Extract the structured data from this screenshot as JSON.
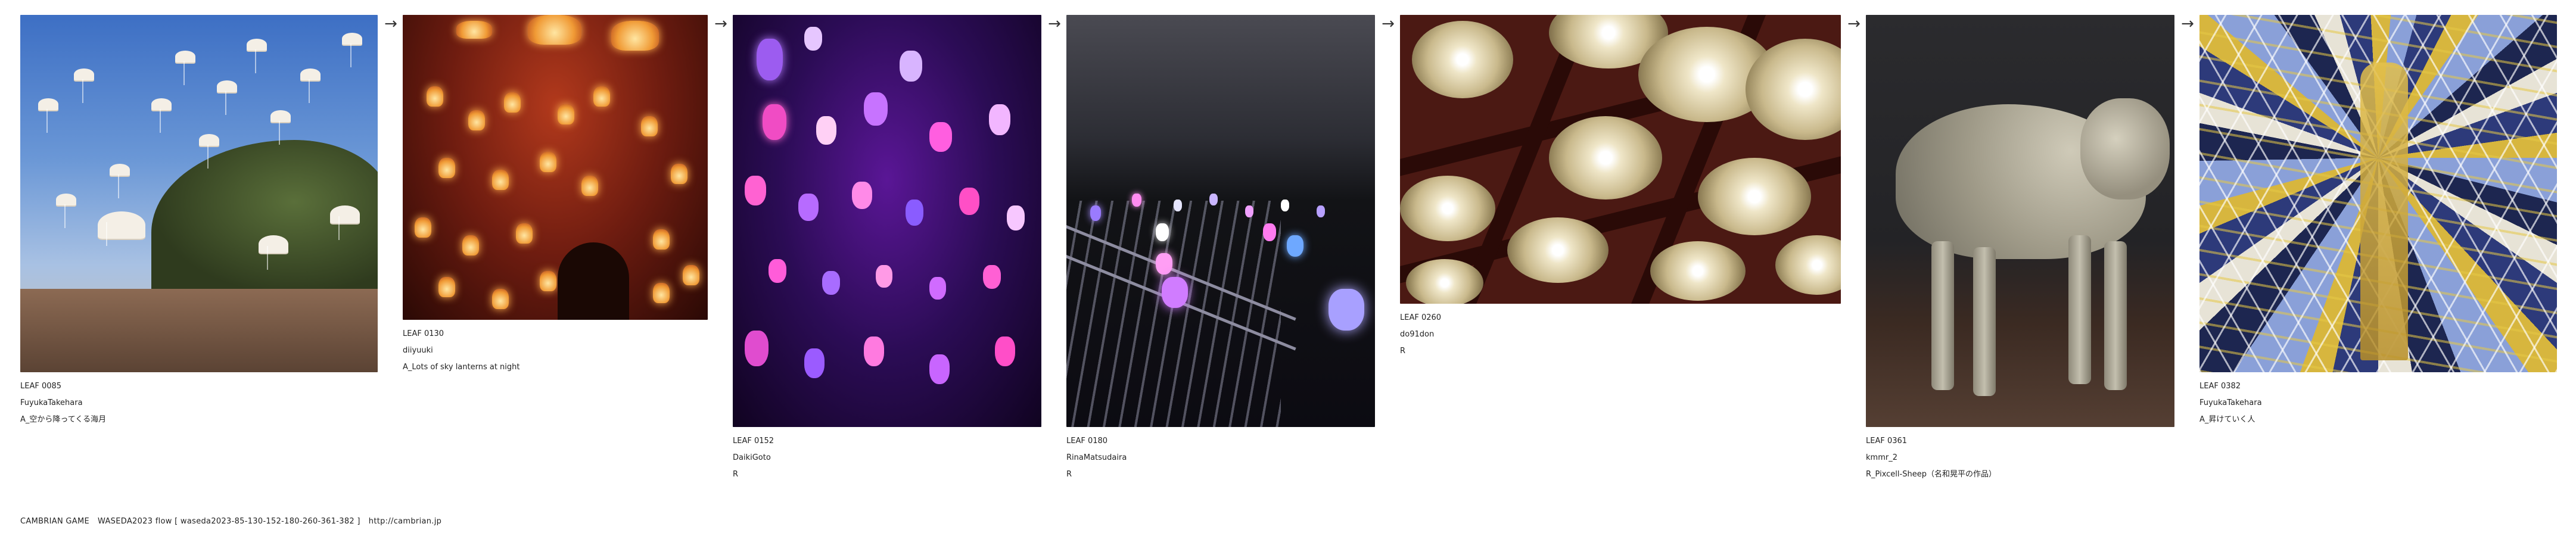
{
  "cards": [
    {
      "leaf": "LEAF 0085",
      "author": "FuyukaTakehara",
      "title": "A_空から降ってくる海月"
    },
    {
      "leaf": "LEAF 0130",
      "author": "diiyuuki",
      "title": "A_Lots of sky lanterns at night"
    },
    {
      "leaf": "LEAF 0152",
      "author": "DaikiGoto",
      "title": "R"
    },
    {
      "leaf": "LEAF 0180",
      "author": "RinaMatsudaira",
      "title": "R"
    },
    {
      "leaf": "LEAF 0260",
      "author": "do91don",
      "title": "R"
    },
    {
      "leaf": "LEAF 0361",
      "author": "kmmr_2",
      "title": "R_Pixcell-Sheep（名和晃平の作品）"
    },
    {
      "leaf": "LEAF 0382",
      "author": "FuyukaTakehara",
      "title": "A_昇けていく人"
    }
  ],
  "arrow_glyph": "→",
  "footer": {
    "game": "CAMBRIAN GAME",
    "flow": "WASEDA2023  flow [ waseda2023-85-130-152-180-260-361-382 ]",
    "url": "http://cambrian.jp"
  }
}
